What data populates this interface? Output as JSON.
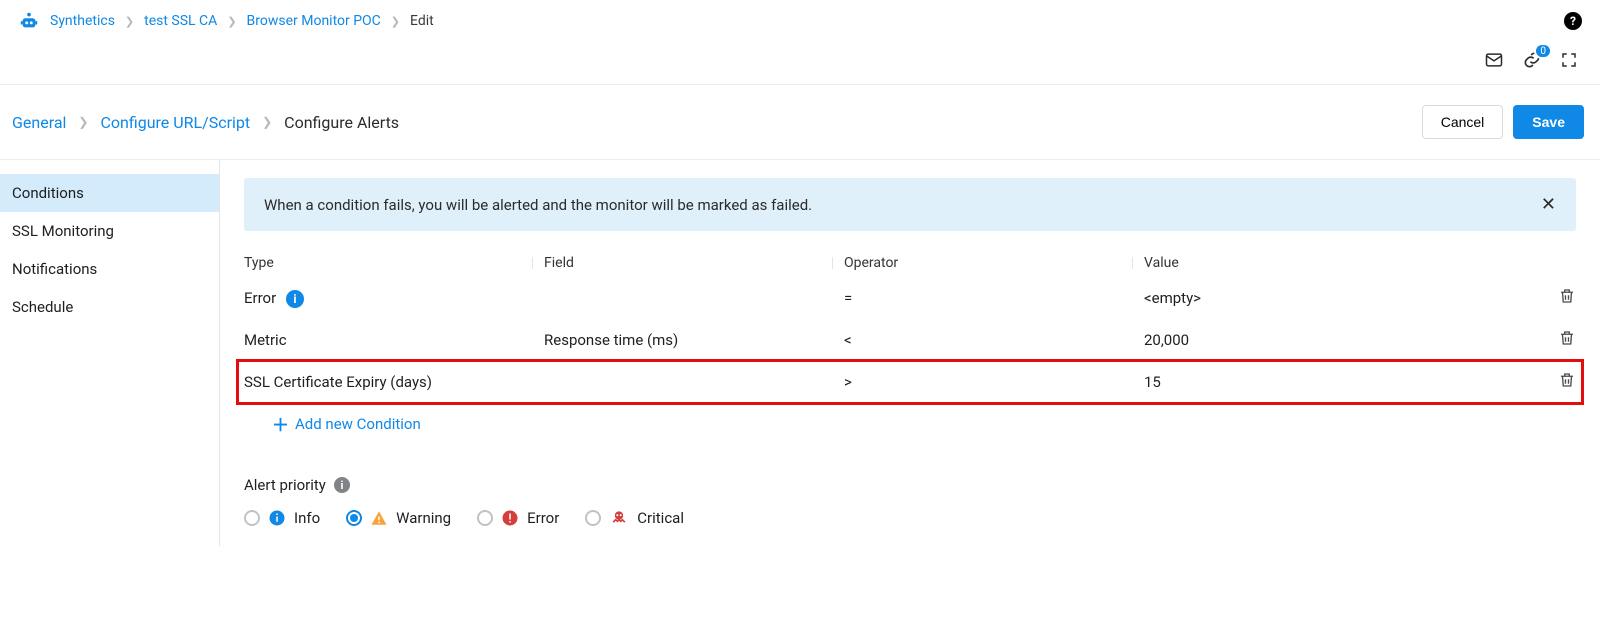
{
  "breadcrumb": {
    "items": [
      "Synthetics",
      "test SSL CA",
      "Browser Monitor POC"
    ],
    "current": "Edit"
  },
  "toolbar": {
    "link_badge": "0"
  },
  "steps": {
    "items": [
      "General",
      "Configure URL/Script"
    ],
    "current": "Configure Alerts",
    "cancel": "Cancel",
    "save": "Save"
  },
  "sidebar": {
    "items": [
      {
        "label": "Conditions",
        "active": true
      },
      {
        "label": "SSL Monitoring",
        "active": false
      },
      {
        "label": "Notifications",
        "active": false
      },
      {
        "label": "Schedule",
        "active": false
      }
    ]
  },
  "banner": {
    "text": "When a condition fails, you will be alerted and the monitor will be marked as failed."
  },
  "table": {
    "headers": {
      "type": "Type",
      "field": "Field",
      "operator": "Operator",
      "value": "Value"
    },
    "rows": [
      {
        "type": "Error",
        "info_icon": true,
        "field": "",
        "operator": "=",
        "value": "<empty>",
        "highlight": false
      },
      {
        "type": "Metric",
        "field": "Response time (ms)",
        "operator": "<",
        "value": "20,000",
        "highlight": false
      },
      {
        "type": "SSL Certificate Expiry (days)",
        "field": "",
        "operator": ">",
        "value": "15",
        "highlight": true
      }
    ],
    "add_label": "Add new Condition"
  },
  "priority": {
    "title": "Alert priority",
    "options": [
      {
        "key": "info",
        "label": "Info",
        "checked": false
      },
      {
        "key": "warning",
        "label": "Warning",
        "checked": true
      },
      {
        "key": "error",
        "label": "Error",
        "checked": false
      },
      {
        "key": "critical",
        "label": "Critical",
        "checked": false
      }
    ]
  }
}
